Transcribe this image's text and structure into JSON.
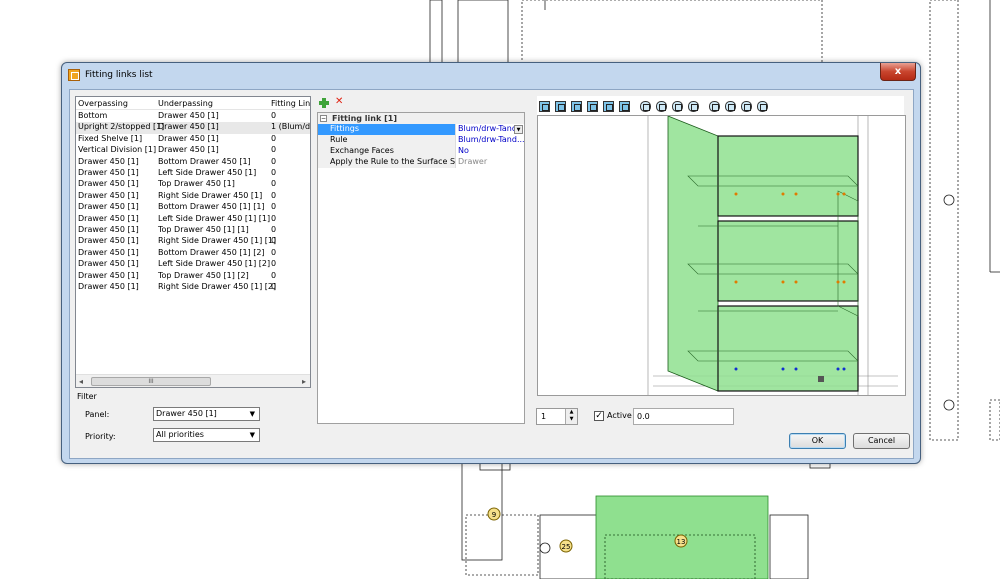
{
  "window": {
    "title": "Fitting links list",
    "close_label": "x"
  },
  "link_list": {
    "columns": [
      "Overpassing",
      "Underpassing",
      "Fitting Lin"
    ],
    "rows": [
      {
        "over": "Bottom",
        "under": "Drawer 450 [1]",
        "fitting": "0"
      },
      {
        "over": "Upright 2/stopped [1]",
        "under": "Drawer 450 [1]",
        "fitting": "1 (Blum/d"
      },
      {
        "over": "Fixed Shelve [1]",
        "under": "Drawer 450 [1]",
        "fitting": "0"
      },
      {
        "over": "Vertical Division [1]",
        "under": "Drawer 450 [1]",
        "fitting": "0"
      },
      {
        "over": "Drawer 450 [1]",
        "under": "Bottom Drawer 450 [1]",
        "fitting": "0"
      },
      {
        "over": "Drawer 450 [1]",
        "under": "Left Side Drawer 450 [1]",
        "fitting": "0"
      },
      {
        "over": "Drawer 450 [1]",
        "under": "Top Drawer 450 [1]",
        "fitting": "0"
      },
      {
        "over": "Drawer 450 [1]",
        "under": "Right Side Drawer 450 [1]",
        "fitting": "0"
      },
      {
        "over": "Drawer 450 [1]",
        "under": "Bottom Drawer 450 [1] [1]",
        "fitting": "0"
      },
      {
        "over": "Drawer 450 [1]",
        "under": "Left Side Drawer 450 [1] [1]",
        "fitting": "0"
      },
      {
        "over": "Drawer 450 [1]",
        "under": "Top Drawer 450 [1] [1]",
        "fitting": "0"
      },
      {
        "over": "Drawer 450 [1]",
        "under": "Right Side Drawer 450 [1] [1]",
        "fitting": "0"
      },
      {
        "over": "Drawer 450 [1]",
        "under": "Bottom Drawer 450 [1] [2]",
        "fitting": "0"
      },
      {
        "over": "Drawer 450 [1]",
        "under": "Left Side Drawer 450 [1] [2]",
        "fitting": "0"
      },
      {
        "over": "Drawer 450 [1]",
        "under": "Top Drawer 450 [1] [2]",
        "fitting": "0"
      },
      {
        "over": "Drawer 450 [1]",
        "under": "Right Side Drawer 450 [1] [2]",
        "fitting": "0"
      }
    ],
    "scroll_thumb": "III"
  },
  "filter": {
    "legend": "Filter",
    "panel_label": "Panel:",
    "panel_value": "Drawer 450 [1]",
    "priority_label": "Priority:",
    "priority_value": "All priorities"
  },
  "properties": {
    "group_title": "Fitting link [1]",
    "group_toggle": "−",
    "rows": [
      {
        "label": "Fittings",
        "value": "Blum/drw-Tand"
      },
      {
        "label": "Rule",
        "value": "Blum/drw-Tand..."
      },
      {
        "label": "Exchange Faces",
        "value": "No"
      },
      {
        "label": "Apply the Rule to the Surface S...",
        "value": "Drawer"
      }
    ]
  },
  "bottom": {
    "spinner_value": "1",
    "active_label": "Active",
    "active_checked": "✓",
    "value_field": "0.0",
    "ok_label": "OK",
    "cancel_label": "Cancel"
  },
  "background_labels": {
    "bubble_a": "9",
    "bubble_b": "25",
    "bubble_c": "13"
  },
  "colors": {
    "selection": "#3399ff",
    "highlight_green": "#8fe08f",
    "link_blue": "#0000c8",
    "close_red": "#c9452e"
  }
}
